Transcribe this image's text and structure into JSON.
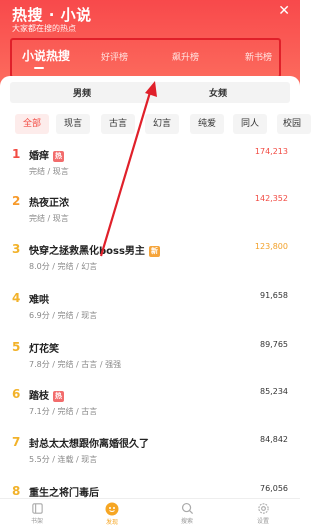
{
  "header": {
    "title": "热搜 · 小说",
    "subtitle": "大家都在搜的热点",
    "close_label": "✕"
  },
  "tabs": [
    {
      "label": "小说热搜",
      "active": true
    },
    {
      "label": "好评榜",
      "active": false
    },
    {
      "label": "飙升榜",
      "active": false
    },
    {
      "label": "新书榜",
      "active": false
    }
  ],
  "gender": [
    "男频",
    "女频"
  ],
  "chips": [
    "全部",
    "现言",
    "古言",
    "幻言",
    "纯爱",
    "同人",
    "校园"
  ],
  "books": [
    {
      "rank": "1",
      "title": "婚痒",
      "badge": "热",
      "meta": "完结 / 现言",
      "count": "174,213"
    },
    {
      "rank": "2",
      "title": "热夜正浓",
      "badge": "",
      "meta": "完结 / 现言",
      "count": "142,352"
    },
    {
      "rank": "3",
      "title": "快穿之拯救黑化boss男主",
      "badge": "新",
      "meta": "8.0分 / 完结 / 幻言",
      "count": "123,800"
    },
    {
      "rank": "4",
      "title": "难哄",
      "badge": "",
      "meta": "6.9分 / 完结 / 现言",
      "count": "91,658"
    },
    {
      "rank": "5",
      "title": "灯花笑",
      "badge": "",
      "meta": "7.8分 / 完结 / 古言 / 强强",
      "count": "89,765"
    },
    {
      "rank": "6",
      "title": "踏枝",
      "badge": "热",
      "meta": "7.1分 / 完结 / 古言",
      "count": "85,234"
    },
    {
      "rank": "7",
      "title": "封总太太想跟你离婚很久了",
      "badge": "",
      "meta": "5.5分 / 连载 / 现言",
      "count": "84,842"
    },
    {
      "rank": "8",
      "title": "重生之将门毒后",
      "badge": "",
      "meta": "",
      "count": "76,056"
    }
  ],
  "bottom_nav": [
    {
      "label": "书架",
      "icon": "bookshelf-icon",
      "active": false
    },
    {
      "label": "发现",
      "icon": "discover-icon",
      "active": true
    },
    {
      "label": "搜索",
      "icon": "search-icon",
      "active": false
    },
    {
      "label": "设置",
      "icon": "settings-icon",
      "active": false
    }
  ],
  "colors": {
    "header_red": "#f8494b",
    "accent_red": "#f24b43",
    "annotation_red": "#e0202a",
    "active_nav": "#f6a623"
  }
}
